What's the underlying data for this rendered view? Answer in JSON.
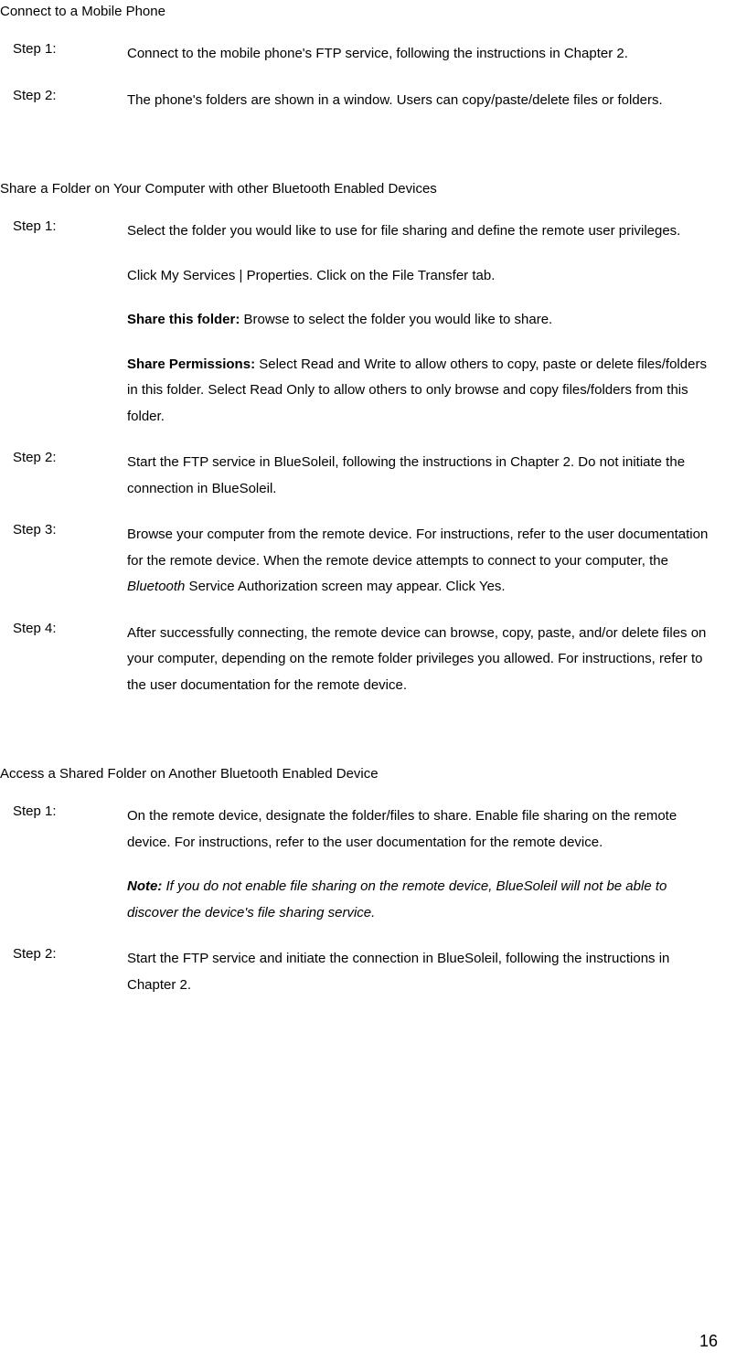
{
  "sections": [
    {
      "title": "Connect to a Mobile Phone",
      "steps": [
        {
          "label": "Step 1:",
          "paras": [
            {
              "runs": [
                {
                  "text": "Connect to the mobile phone's FTP service, following the instructions in Chapter 2."
                }
              ]
            }
          ]
        },
        {
          "label": "Step 2:",
          "paras": [
            {
              "runs": [
                {
                  "text": "The phone's folders are shown in a window. Users can copy/paste/delete files or folders."
                }
              ]
            }
          ]
        }
      ]
    },
    {
      "title": "Share a Folder on Your Computer with other Bluetooth Enabled Devices",
      "steps": [
        {
          "label": "Step 1:",
          "paras": [
            {
              "runs": [
                {
                  "text": "Select the folder you would like to use for file sharing and define the remote user privileges."
                }
              ]
            },
            {
              "runs": [
                {
                  "text": "Click My Services | Properties. Click on the File Transfer tab."
                }
              ]
            },
            {
              "runs": [
                {
                  "text": "Share this folder: ",
                  "bold": true
                },
                {
                  "text": "Browse to select the folder you would like to share."
                }
              ]
            },
            {
              "runs": [
                {
                  "text": "Share Permissions: ",
                  "bold": true
                },
                {
                  "text": "Select Read and Write to allow others to copy, paste or delete files/folders in this folder. Select Read Only to allow others to only browse and copy files/folders from this folder."
                }
              ]
            }
          ]
        },
        {
          "label": "Step 2:",
          "paras": [
            {
              "runs": [
                {
                  "text": "Start the FTP service in BlueSoleil, following the instructions in Chapter 2. Do not initiate the connection in BlueSoleil."
                }
              ]
            }
          ]
        },
        {
          "label": "Step 3:",
          "paras": [
            {
              "runs": [
                {
                  "text": "Browse your computer from the remote device. For instructions, refer to the user documentation for the remote device. When the remote device attempts to connect to your computer, the "
                },
                {
                  "text": "Bluetooth",
                  "italic": true
                },
                {
                  "text": " Service Authorization screen may appear. Click Yes."
                }
              ]
            }
          ]
        },
        {
          "label": "Step 4:",
          "paras": [
            {
              "runs": [
                {
                  "text": "After successfully connecting, the remote device can browse, copy, paste, and/or delete files on your computer, depending on the remote folder privileges you allowed. For instructions, refer to the user documentation for the remote device."
                }
              ]
            }
          ]
        }
      ]
    },
    {
      "title": "Access a Shared Folder on Another Bluetooth Enabled Device",
      "steps": [
        {
          "label": "Step 1:",
          "paras": [
            {
              "runs": [
                {
                  "text": "On the remote device, designate the folder/files to share. Enable file sharing on the remote device. For instructions, refer to the user documentation for the remote device."
                }
              ]
            },
            {
              "runs": [
                {
                  "text": "Note:",
                  "bold": true,
                  "italic": true
                },
                {
                  "text": " If you do not enable file sharing on the remote device, BlueSoleil will not be able to discover the device's file sharing service.",
                  "italic": true
                }
              ]
            }
          ]
        },
        {
          "label": "Step 2:",
          "paras": [
            {
              "runs": [
                {
                  "text": "Start the FTP service and initiate the connection in BlueSoleil, following the instructions in Chapter 2."
                }
              ]
            }
          ]
        }
      ]
    }
  ],
  "pageNumber": "16"
}
